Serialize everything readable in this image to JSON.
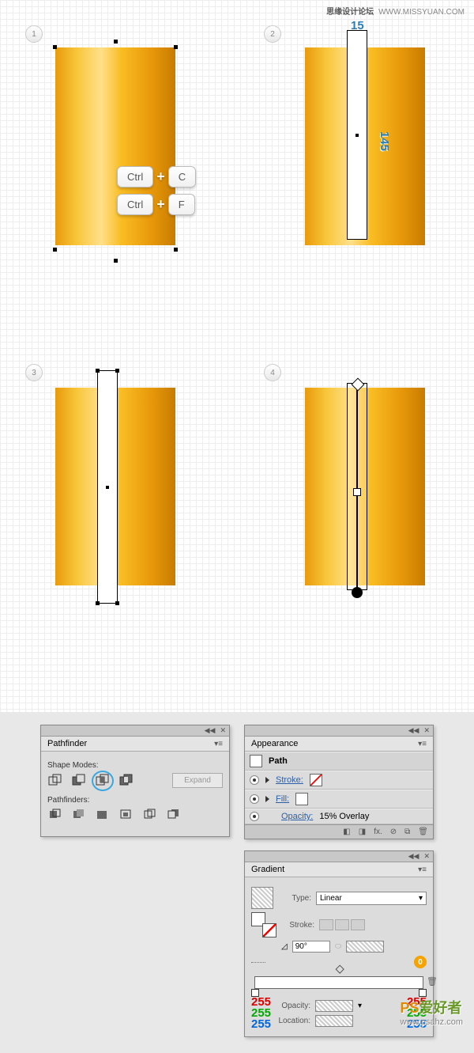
{
  "watermark_top": {
    "cn": "思缘设计论坛",
    "url": "WWW.MISSYUAN.COM"
  },
  "steps": {
    "s1": "1",
    "s2": "2",
    "s3": "3",
    "s4": "4"
  },
  "shortcuts": {
    "row1": {
      "k1": "Ctrl",
      "plus": "+",
      "k2": "C"
    },
    "row2": {
      "k1": "Ctrl",
      "plus": "+",
      "k2": "F"
    }
  },
  "dimensions": {
    "width": "15",
    "height": "145"
  },
  "pathfinder": {
    "title": "Pathfinder",
    "shape_modes_label": "Shape Modes:",
    "expand": "Expand",
    "pathfinders_label": "Pathfinders:"
  },
  "appearance": {
    "title": "Appearance",
    "object_label": "Path",
    "stroke_label": "Stroke:",
    "fill_label": "Fill:",
    "opacity_label": "Opacity:",
    "opacity_value": "15% Overlay",
    "footer_fx": "fx."
  },
  "gradient": {
    "title": "Gradient",
    "type_label": "Type:",
    "type_value": "Linear",
    "stroke_label": "Stroke:",
    "angle_value": "90°",
    "ratio_value": "",
    "zero": "0",
    "opacity_label": "Opacity:",
    "location_label": "Location:",
    "rgb_left": {
      "r": "255",
      "g": "255",
      "b": "255"
    },
    "rgb_right": {
      "r": "255",
      "g": "255",
      "b": "255"
    }
  },
  "watermark_bottom": {
    "brand_a": "PS",
    "brand_b": "爱好者",
    "url": "www.psahz.com"
  }
}
